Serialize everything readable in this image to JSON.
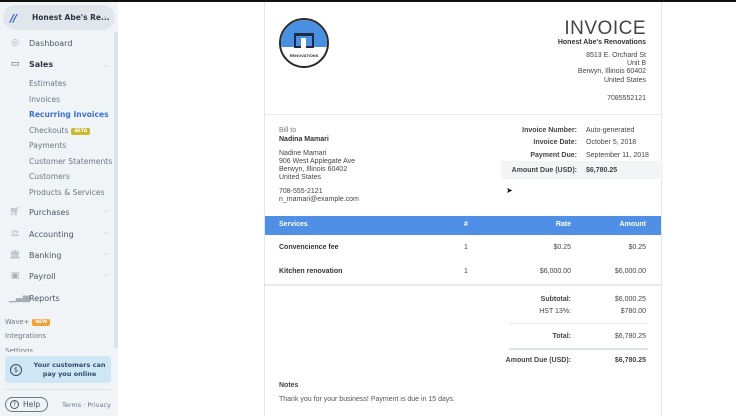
{
  "sidebar": {
    "business_name": "Honest Abe's Re...",
    "nav": [
      {
        "label": "Dashboard",
        "icon": "dashboard-icon"
      },
      {
        "label": "Sales",
        "icon": "sales-icon"
      },
      {
        "label": "Purchases",
        "icon": "cart-icon"
      },
      {
        "label": "Accounting",
        "icon": "scale-icon"
      },
      {
        "label": "Banking",
        "icon": "bank-icon"
      },
      {
        "label": "Payroll",
        "icon": "payroll-icon"
      },
      {
        "label": "Reports",
        "icon": "bar-chart-icon"
      }
    ],
    "sales_sub": [
      "Estimates",
      "Invoices",
      "Recurring Invoices",
      "Checkouts",
      "Payments",
      "Customer Statements",
      "Customers",
      "Products & Services"
    ],
    "beta_badge": "BETA",
    "wave_plus": "Wave+",
    "new_badge": "NEW",
    "integrations": "Integrations",
    "settings": "Settings",
    "promo": "Your customers can pay you online",
    "help": "Help",
    "terms": "Terms",
    "privacy": "Privacy",
    "accent": "#3b6fd1"
  },
  "invoice": {
    "title": "INVOICE",
    "logo_text": "HONEST ABE'S RENOVATIONS",
    "company": "Honest Abe's Renovations",
    "address": [
      "8513 E. Orchard St",
      "Unit B",
      "Berwyn, Illinois 60402",
      "United States"
    ],
    "phone": "7085552121",
    "bill_to_label": "Bill to",
    "customer": "Nadina Mamari",
    "customer_address": [
      "Nadine Mamari",
      "906 West Applegate Ave",
      "Berwyn, Illinois 60402",
      "United States"
    ],
    "customer_phone": "708-555-2121",
    "customer_email": "n_mamari@example.com",
    "meta": [
      {
        "label": "Invoice Number:",
        "value": "Auto-generated"
      },
      {
        "label": "Invoice Date:",
        "value": "October 5, 2018"
      },
      {
        "label": "Payment Due:",
        "value": "September 11, 2018"
      },
      {
        "label": "Amount Due (USD):",
        "value": "$6,780.25"
      }
    ],
    "columns": [
      "Services",
      "#",
      "Rate",
      "Amount"
    ],
    "items": [
      {
        "name": "Convencience fee",
        "qty": "1",
        "rate": "$0.25",
        "amount": "$0.25"
      },
      {
        "name": "Kitchen renovation",
        "qty": "1",
        "rate": "$6,000.00",
        "amount": "$6,000.00"
      }
    ],
    "totals": [
      {
        "label": "Subtotal:",
        "value": "$6,000.25"
      },
      {
        "label": "HST 13%:",
        "value": "$780.00"
      },
      {
        "label": "Total:",
        "value": "$6,780.25"
      },
      {
        "label": "Amount Due (USD):",
        "value": "$6,780.25"
      }
    ],
    "notes_label": "Notes",
    "notes": "Thank you for your business! Payment is due in 15 days.",
    "header_color": "#4f8fe6"
  }
}
